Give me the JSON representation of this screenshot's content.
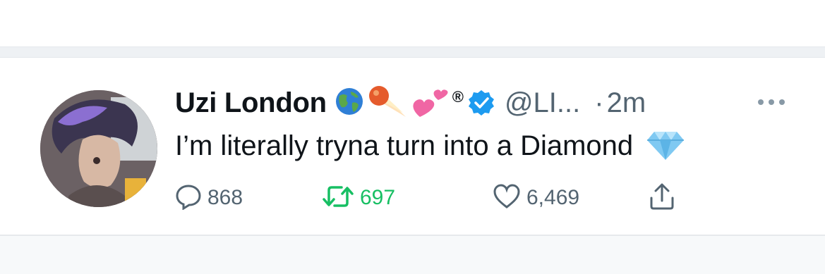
{
  "tweet": {
    "display_name": "Uzi London",
    "name_emojis": [
      "globe-emoji",
      "comet-emoji",
      "two-hearts-emoji"
    ],
    "registered_mark": "®",
    "handle": "@LI...",
    "separator_dot": "·",
    "timestamp": "2m",
    "text": "I’m literally tryna turn into a Diamond",
    "text_emoji": "diamond-emoji",
    "counts": {
      "replies": "868",
      "retweets": "697",
      "likes": "6,469"
    },
    "icons": {
      "reply": "reply-icon",
      "retweet": "retweet-icon",
      "like": "heart-icon",
      "share": "share-icon",
      "more": "more-icon",
      "verified": "verified-badge-icon"
    }
  },
  "colors": {
    "text_primary": "#0f1419",
    "text_secondary": "#536471",
    "retweet_active": "#17bf63",
    "verified": "#1d9bf0",
    "separator": "#eef1f4"
  }
}
